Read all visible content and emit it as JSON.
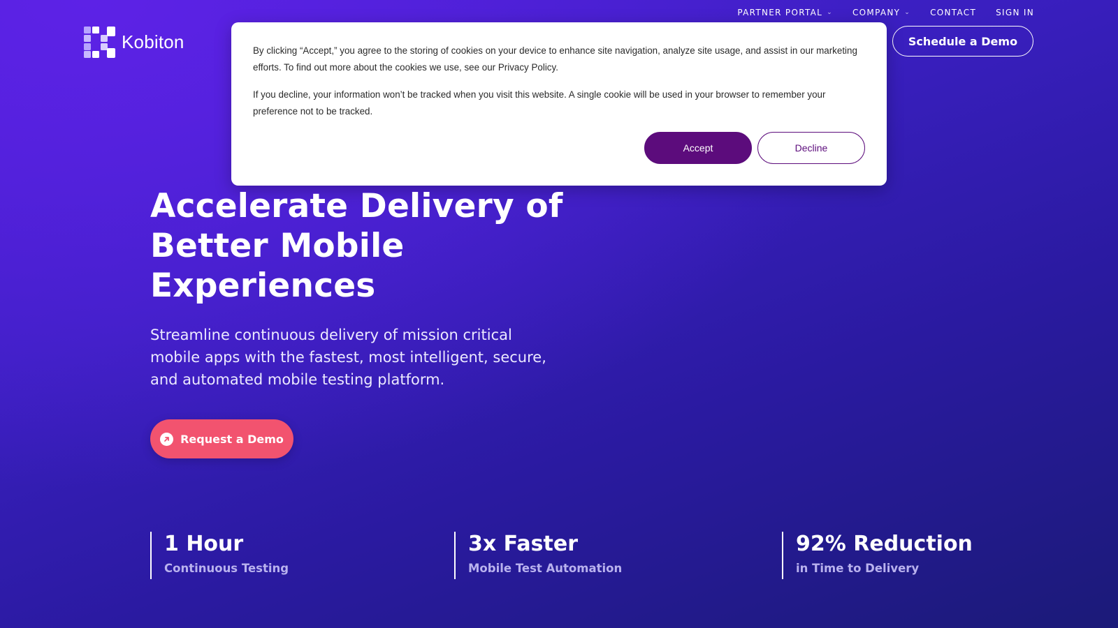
{
  "utility_nav": {
    "items": [
      {
        "label": "PARTNER PORTAL",
        "has_dropdown": true
      },
      {
        "label": "COMPANY",
        "has_dropdown": true
      },
      {
        "label": "CONTACT",
        "has_dropdown": false
      },
      {
        "label": "SIGN IN",
        "has_dropdown": false
      }
    ]
  },
  "logo": {
    "text": "Kobiton"
  },
  "header": {
    "schedule_demo_label": "Schedule a Demo"
  },
  "cookie_banner": {
    "paragraph1_text": "By clicking “Accept,” you agree to the storing of cookies on your device to enhance site navigation, analyze site usage, and assist in our marketing efforts. To find out more about the cookies we use, see our ",
    "privacy_link": "Privacy Policy",
    "paragraph1_end": ".",
    "paragraph2_text": "If you decline, your information won’t be tracked when you visit this website. A single cookie will be used in your browser to remember your preference not to be tracked.",
    "accept_label": "Accept",
    "decline_label": "Decline",
    "accent_color": "#5c0c7c"
  },
  "hero": {
    "title": "Accelerate Delivery of Better Mobile Experiences",
    "subtitle": "Streamline continuous delivery of mission critical mobile apps with the fastest, most intelligent, secure, and automated mobile testing platform.",
    "cta_label": "Request a Demo",
    "cta_color": "#f2536f",
    "cta_icon": "arrow-up-right-icon"
  },
  "stats": [
    {
      "value": "1 Hour",
      "label": "Continuous Testing"
    },
    {
      "value": "3x Faster",
      "label": "Mobile Test Automation"
    },
    {
      "value": "92% Reduction",
      "label": "in Time to Delivery"
    }
  ],
  "colors": {
    "background_start": "#4a1fd6",
    "background_end": "#1b1a78",
    "stat_label": "#b9b2ee"
  }
}
